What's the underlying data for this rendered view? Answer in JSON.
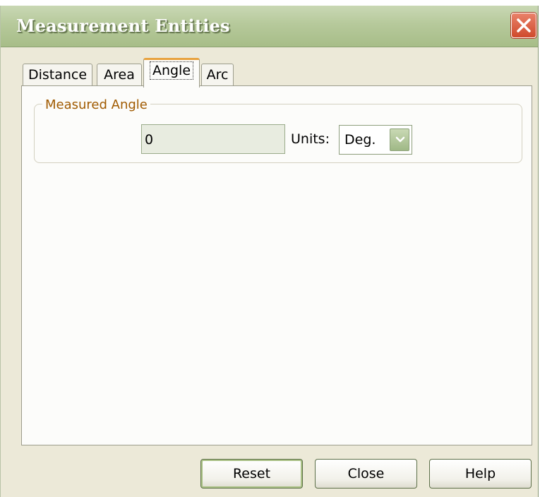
{
  "window": {
    "title": "Measurement Entities"
  },
  "tabs": [
    {
      "label": "Distance"
    },
    {
      "label": "Area"
    },
    {
      "label": "Angle",
      "active": true
    },
    {
      "label": "Arc"
    }
  ],
  "angle_panel": {
    "group_label": "Measured Angle",
    "value": "0",
    "units_label": "Units:",
    "units_selected": "Deg."
  },
  "buttons": {
    "reset": "Reset",
    "close": "Close",
    "help": "Help"
  },
  "colors": {
    "title_bar": "#b6c99b",
    "accent_tab": "#e8a23e",
    "group_label": "#a05a00",
    "close_button": "#cf4a2c"
  }
}
